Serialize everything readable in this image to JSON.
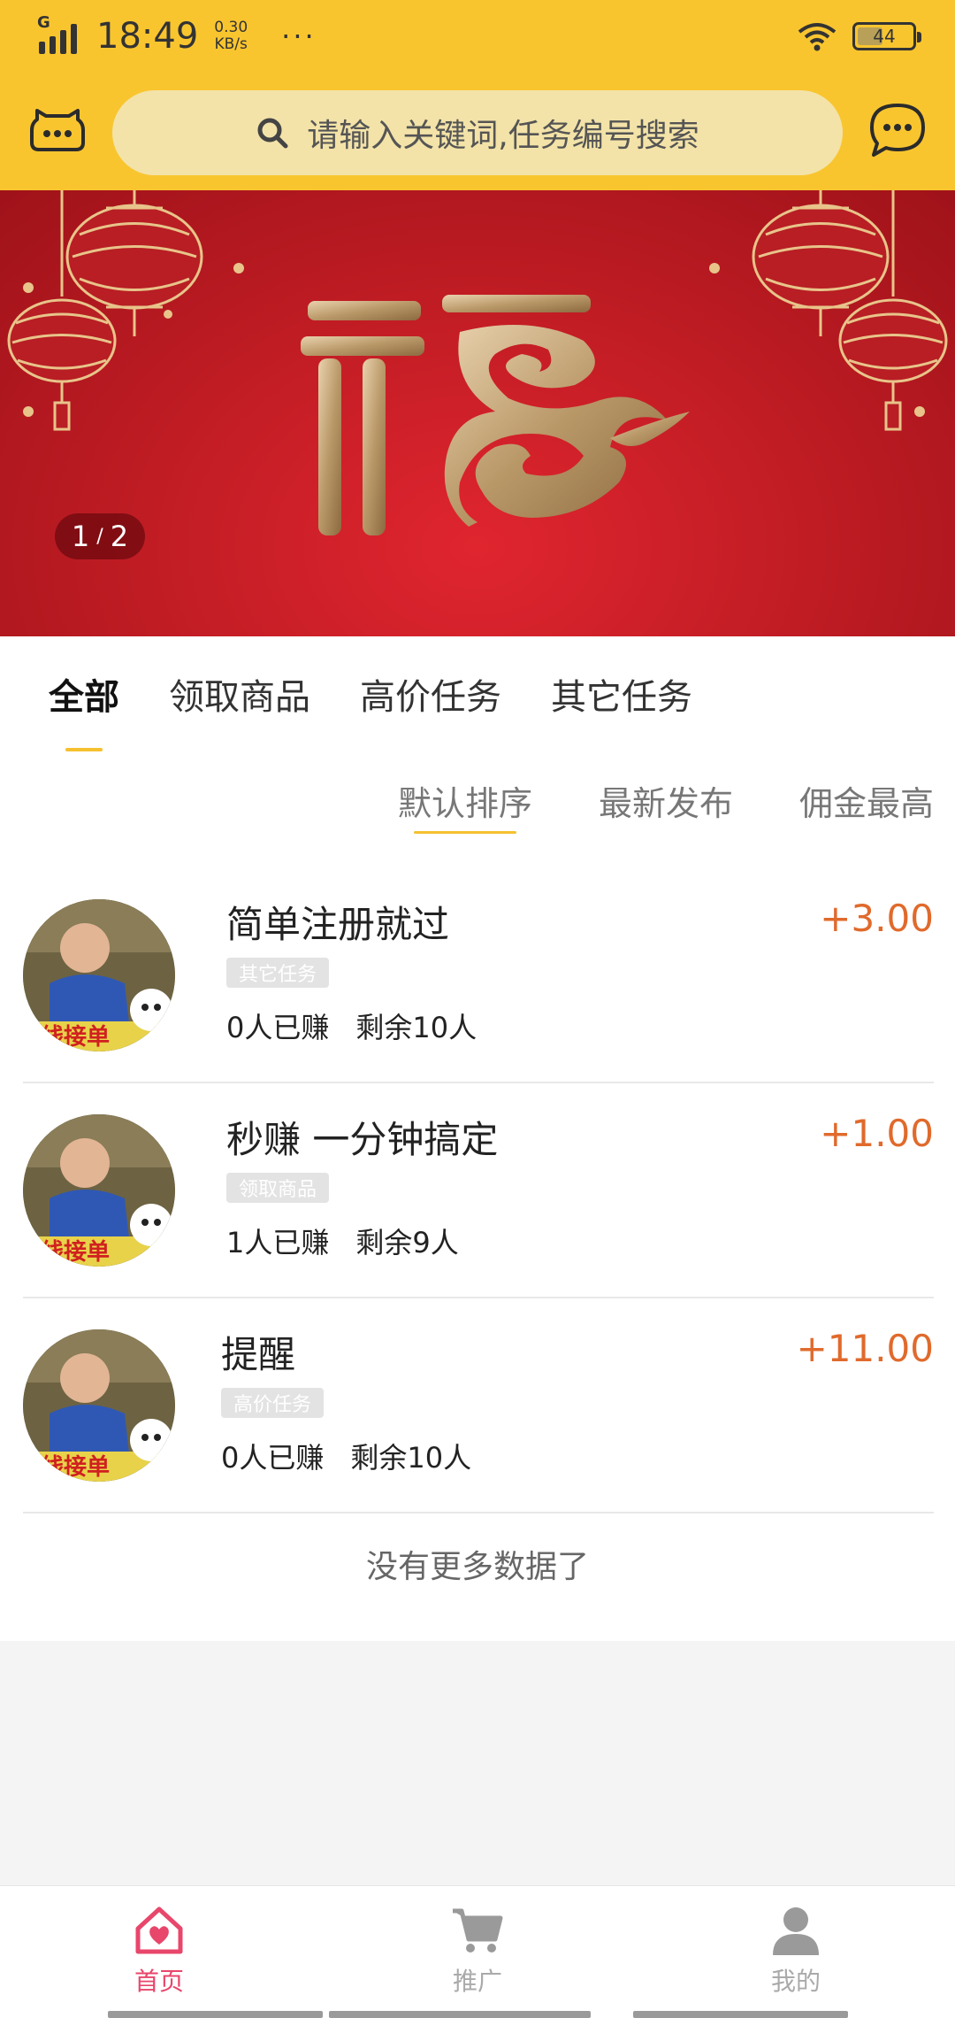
{
  "status_bar": {
    "network": "G",
    "time": "18:49",
    "speed_value": "0.30",
    "speed_unit": "KB/s",
    "dots": "···",
    "battery": "44"
  },
  "header": {
    "search_placeholder": "请输入关键词,任务编号搜索",
    "left_icon": "chat-bubble-icon",
    "right_icon": "message-icon"
  },
  "banner": {
    "counter_current": "1",
    "counter_sep": "/",
    "counter_total": "2",
    "theme_color": "#c31d25"
  },
  "tabs": [
    {
      "label": "全部",
      "active": true
    },
    {
      "label": "领取商品",
      "active": false
    },
    {
      "label": "高价任务",
      "active": false
    },
    {
      "label": "其它任务",
      "active": false
    }
  ],
  "sort": [
    {
      "label": "默认排序",
      "active": true
    },
    {
      "label": "最新发布",
      "active": false
    },
    {
      "label": "佣金最高",
      "active": false
    }
  ],
  "tasks": [
    {
      "title": "简单注册就过",
      "badge": "其它任务",
      "earned": "0人已赚",
      "remaining": "剩余10人",
      "reward": "+3.00",
      "avatar_text": "线接单"
    },
    {
      "title": "秒赚 一分钟搞定",
      "badge": "领取商品",
      "earned": "1人已赚",
      "remaining": "剩余9人",
      "reward": "+1.00",
      "avatar_text": "线接单"
    },
    {
      "title": "提醒",
      "badge": "高价任务",
      "earned": "0人已赚",
      "remaining": "剩余10人",
      "reward": "+11.00",
      "avatar_text": "线接单"
    }
  ],
  "no_more": "没有更多数据了",
  "bottom_nav": [
    {
      "label": "首页",
      "icon": "home-heart-icon",
      "active": true
    },
    {
      "label": "推广",
      "icon": "cart-icon",
      "active": false
    },
    {
      "label": "我的",
      "icon": "user-icon",
      "active": false
    }
  ],
  "colors": {
    "accent_yellow": "#f9c52f",
    "reward_orange": "#e06a2c",
    "nav_active": "#e8466b"
  }
}
